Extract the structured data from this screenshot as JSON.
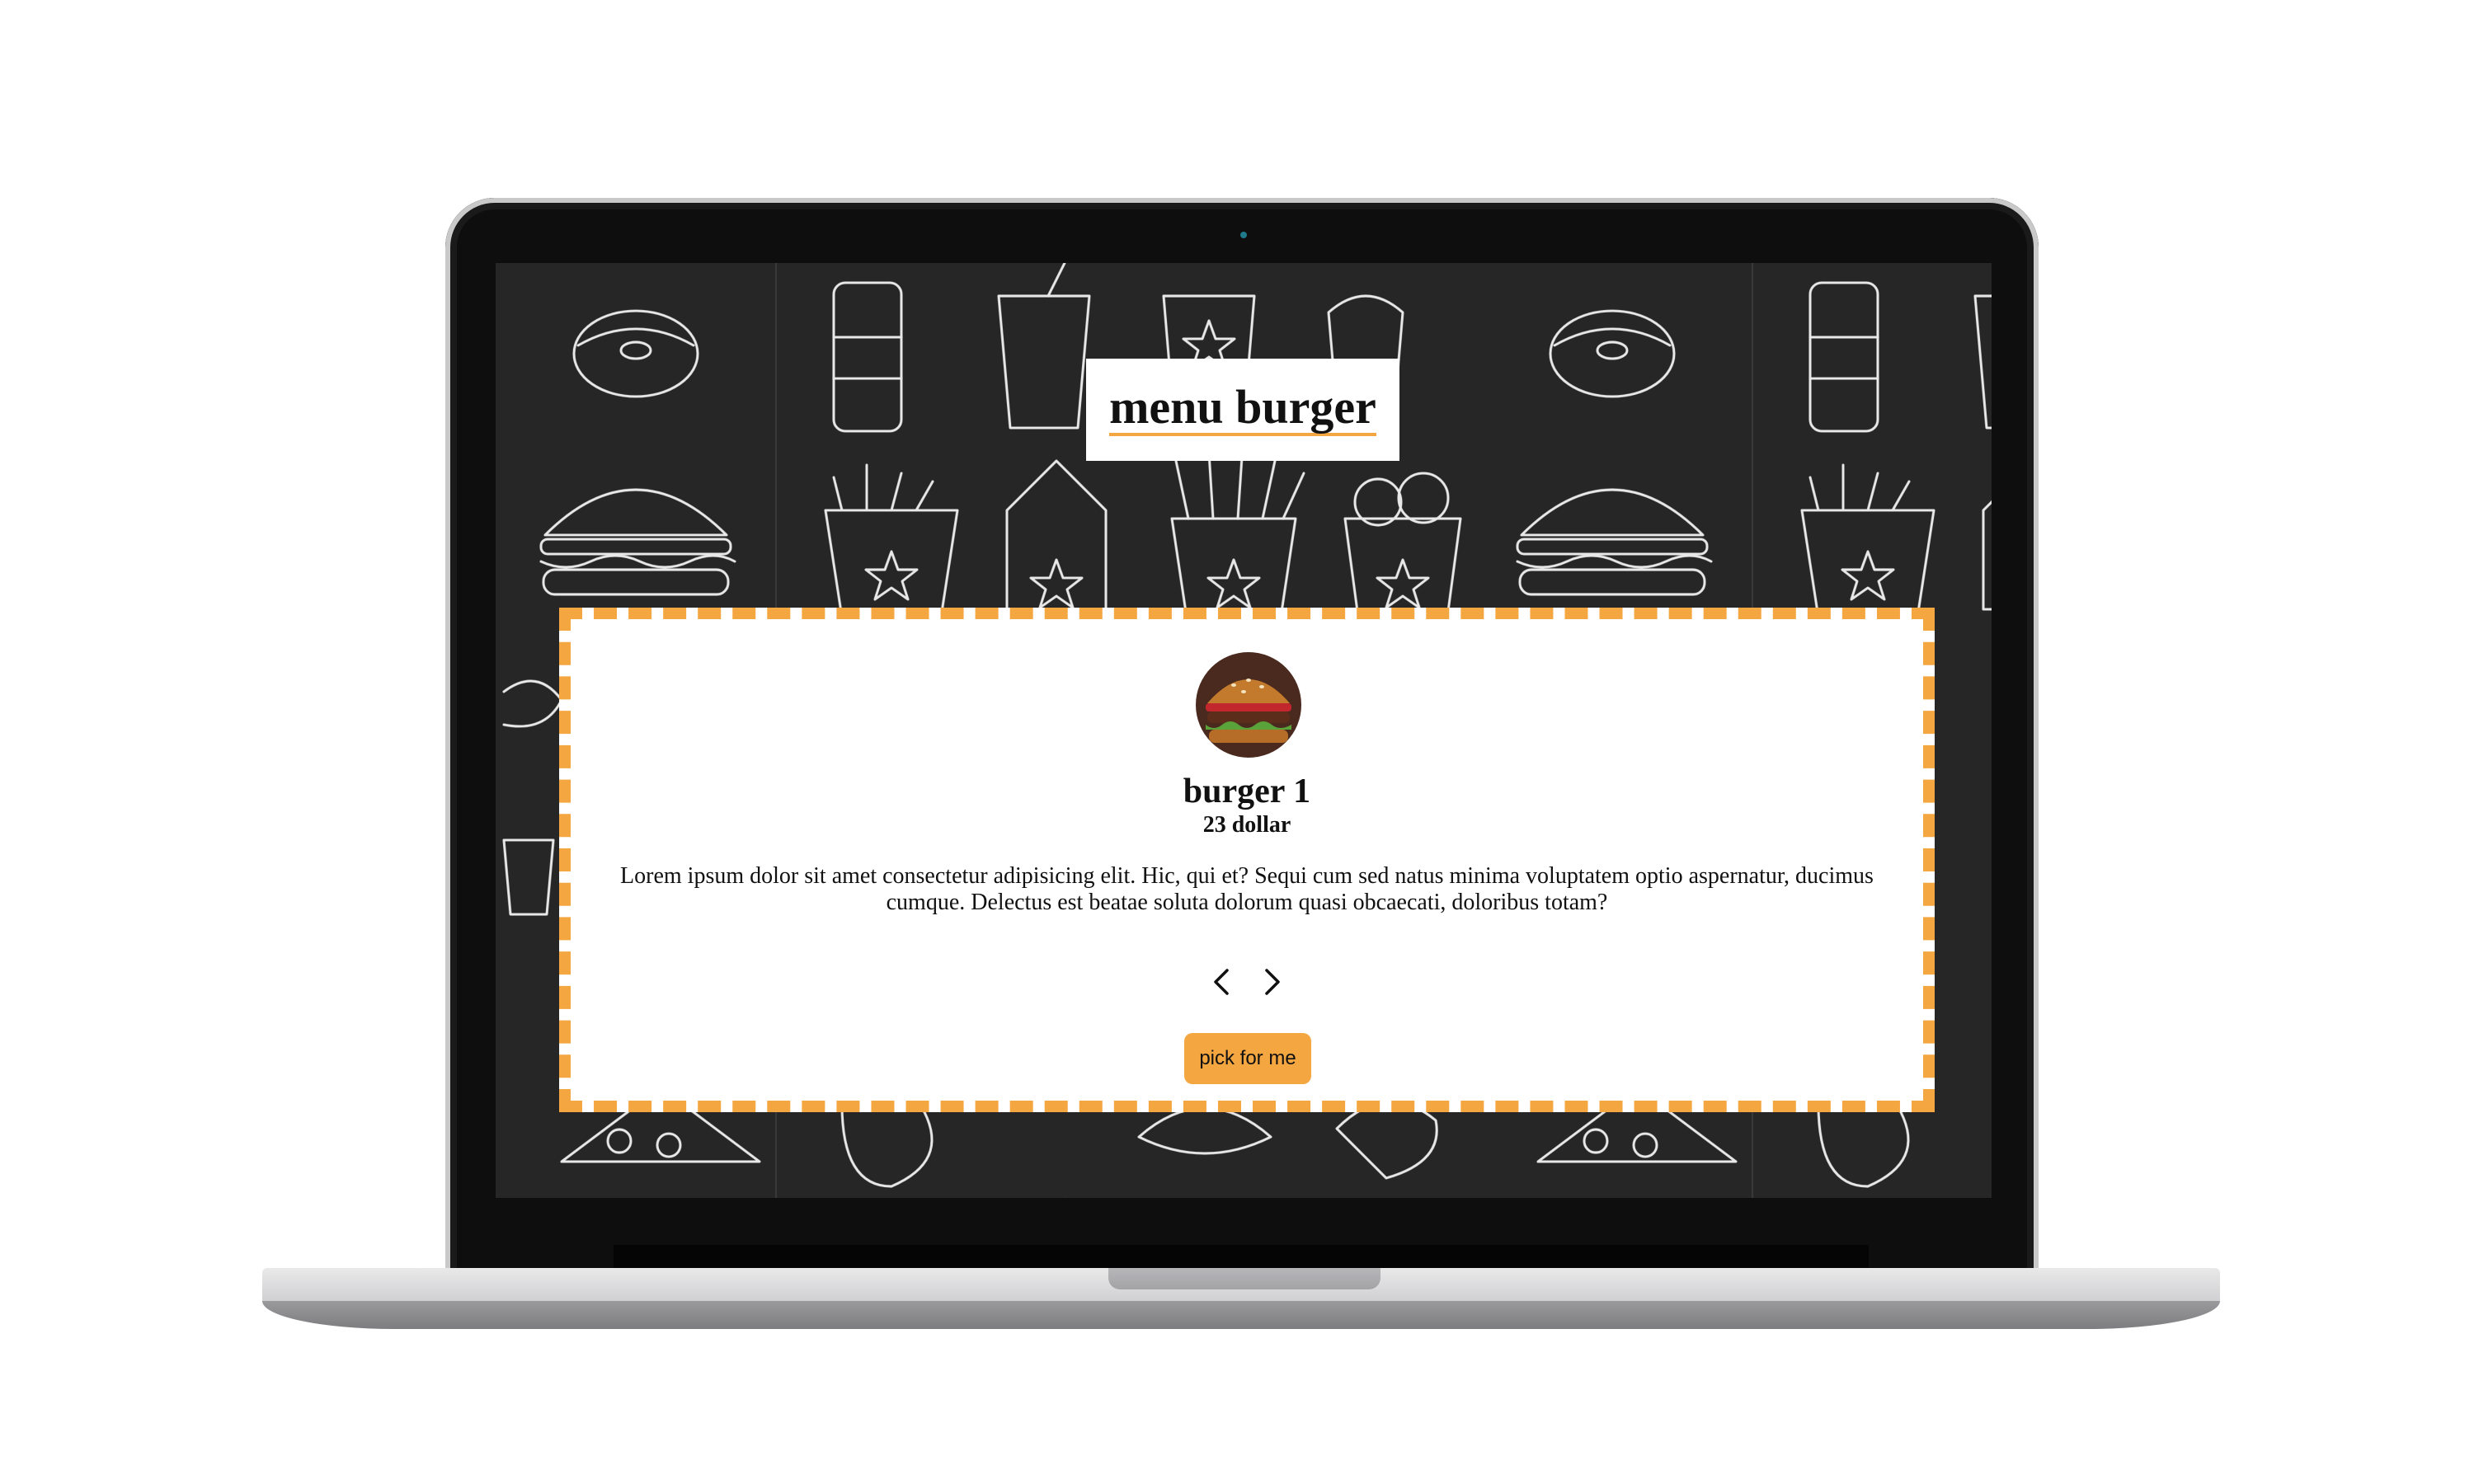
{
  "page": {
    "title": "menu burger"
  },
  "menu_item": {
    "name": "burger 1",
    "price": "23 dollar",
    "description": "Lorem ipsum dolor sit amet consectetur adipisicing elit. Hic, qui et? Sequi cum sed natus minima voluptatem optio aspernatur, ducimus cumque. Delectus est beatae soluta dolorum quasi obcaecati, doloribus totam?",
    "image_icon": "burger-photo-icon"
  },
  "controls": {
    "prev_icon": "chevron-left-icon",
    "next_icon": "chevron-right-icon",
    "pick_label": "pick for me"
  },
  "colors": {
    "accent": "#f4a640",
    "screen_background": "#262626",
    "card_background": "#ffffff",
    "text": "#111111"
  }
}
